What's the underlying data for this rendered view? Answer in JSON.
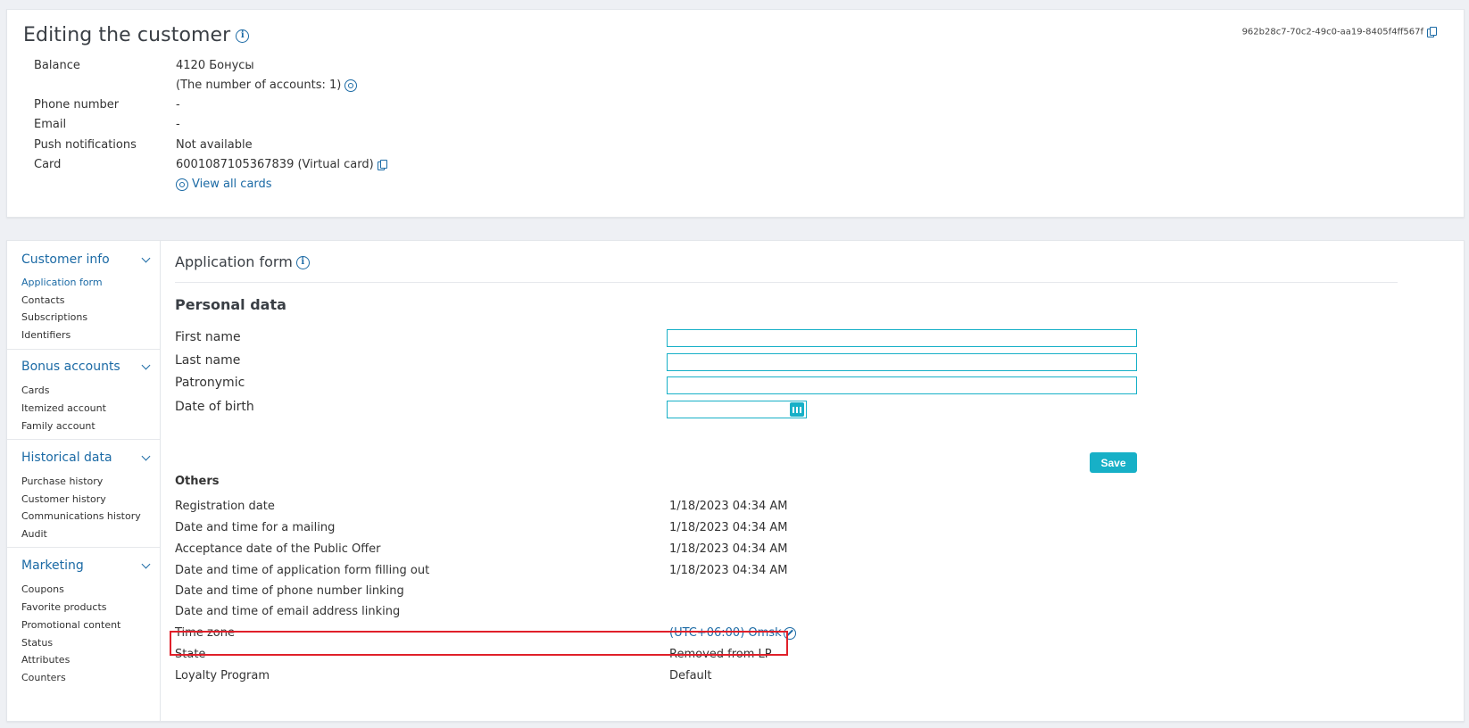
{
  "header": {
    "title": "Editing the customer",
    "guid": "962b28c7-70c2-49c0-aa19-8405f4ff567f"
  },
  "customer": {
    "balance_label": "Balance",
    "balance_value": "4120 Бонусы",
    "accounts_text": "(The number of accounts: 1)",
    "phone_label": "Phone number",
    "phone_value": "-",
    "email_label": "Email",
    "email_value": "-",
    "push_label": "Push notifications",
    "push_value": "Not available",
    "card_label": "Card",
    "card_value": "6001087105367839 (Virtual card)",
    "view_all_cards": "View all cards"
  },
  "sidebar": {
    "groups": [
      {
        "title": "Customer info",
        "items": [
          "Application form",
          "Contacts",
          "Subscriptions",
          "Identifiers"
        ]
      },
      {
        "title": "Bonus accounts",
        "items": [
          "Cards",
          "Itemized account",
          "Family account"
        ]
      },
      {
        "title": "Historical data",
        "items": [
          "Purchase history",
          "Customer history",
          "Communications history",
          "Audit"
        ]
      },
      {
        "title": "Marketing",
        "items": [
          "Coupons",
          "Favorite products",
          "Promotional content",
          "Status",
          "Attributes",
          "Counters"
        ]
      }
    ]
  },
  "form": {
    "title": "Application form",
    "personal_title": "Personal data",
    "first_name_label": "First name",
    "last_name_label": "Last name",
    "patronymic_label": "Patronymic",
    "dob_label": "Date of birth",
    "save_label": "Save"
  },
  "others": {
    "title": "Others",
    "rows": [
      {
        "label": "Registration date",
        "value": "1/18/2023 04:34 AM"
      },
      {
        "label": "Date and time for a mailing",
        "value": "1/18/2023 04:34 AM"
      },
      {
        "label": "Acceptance date of the Public Offer",
        "value": "1/18/2023 04:34 AM"
      },
      {
        "label": "Date and time of application form filling out",
        "value": "1/18/2023 04:34 AM"
      },
      {
        "label": "Date and time of phone number linking",
        "value": ""
      },
      {
        "label": "Date and time of email address linking",
        "value": ""
      },
      {
        "label": "Time zone",
        "value": "(UTC+06:00) Omsk"
      },
      {
        "label": "State",
        "value": "Removed from LP"
      },
      {
        "label": "Loyalty Program",
        "value": "Default"
      }
    ]
  },
  "colors": {
    "accent": "#17b0c7",
    "link": "#1b6aa5",
    "highlight": "#e0202a"
  }
}
